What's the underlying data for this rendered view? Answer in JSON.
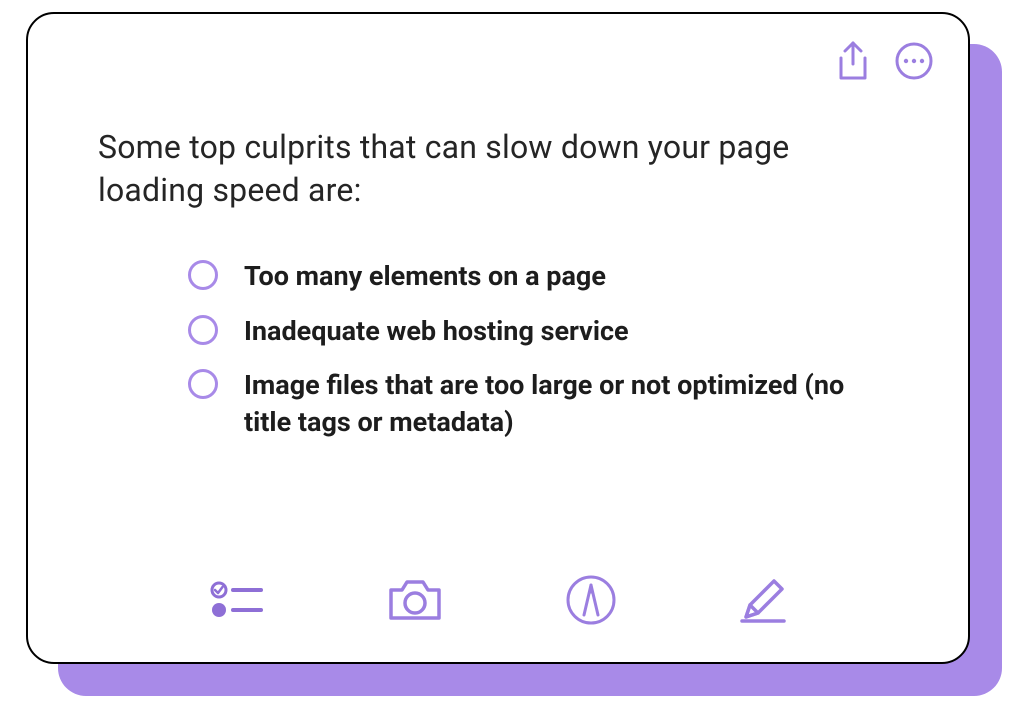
{
  "card": {
    "intro": "Some top culprits that can slow down your page loading speed are:",
    "items": [
      "Too many elements on a page",
      "Inadequate web hosting service",
      "Image files that are too large or not optimized (no title tags or metadata)"
    ]
  },
  "colors": {
    "accent": "#a88ae8",
    "accent_fill": "#9b7ee0"
  },
  "icons": {
    "share": "share-icon",
    "more": "more-icon",
    "checklist": "checklist-icon",
    "camera": "camera-icon",
    "draw": "draw-icon",
    "pencil": "pencil-icon"
  }
}
